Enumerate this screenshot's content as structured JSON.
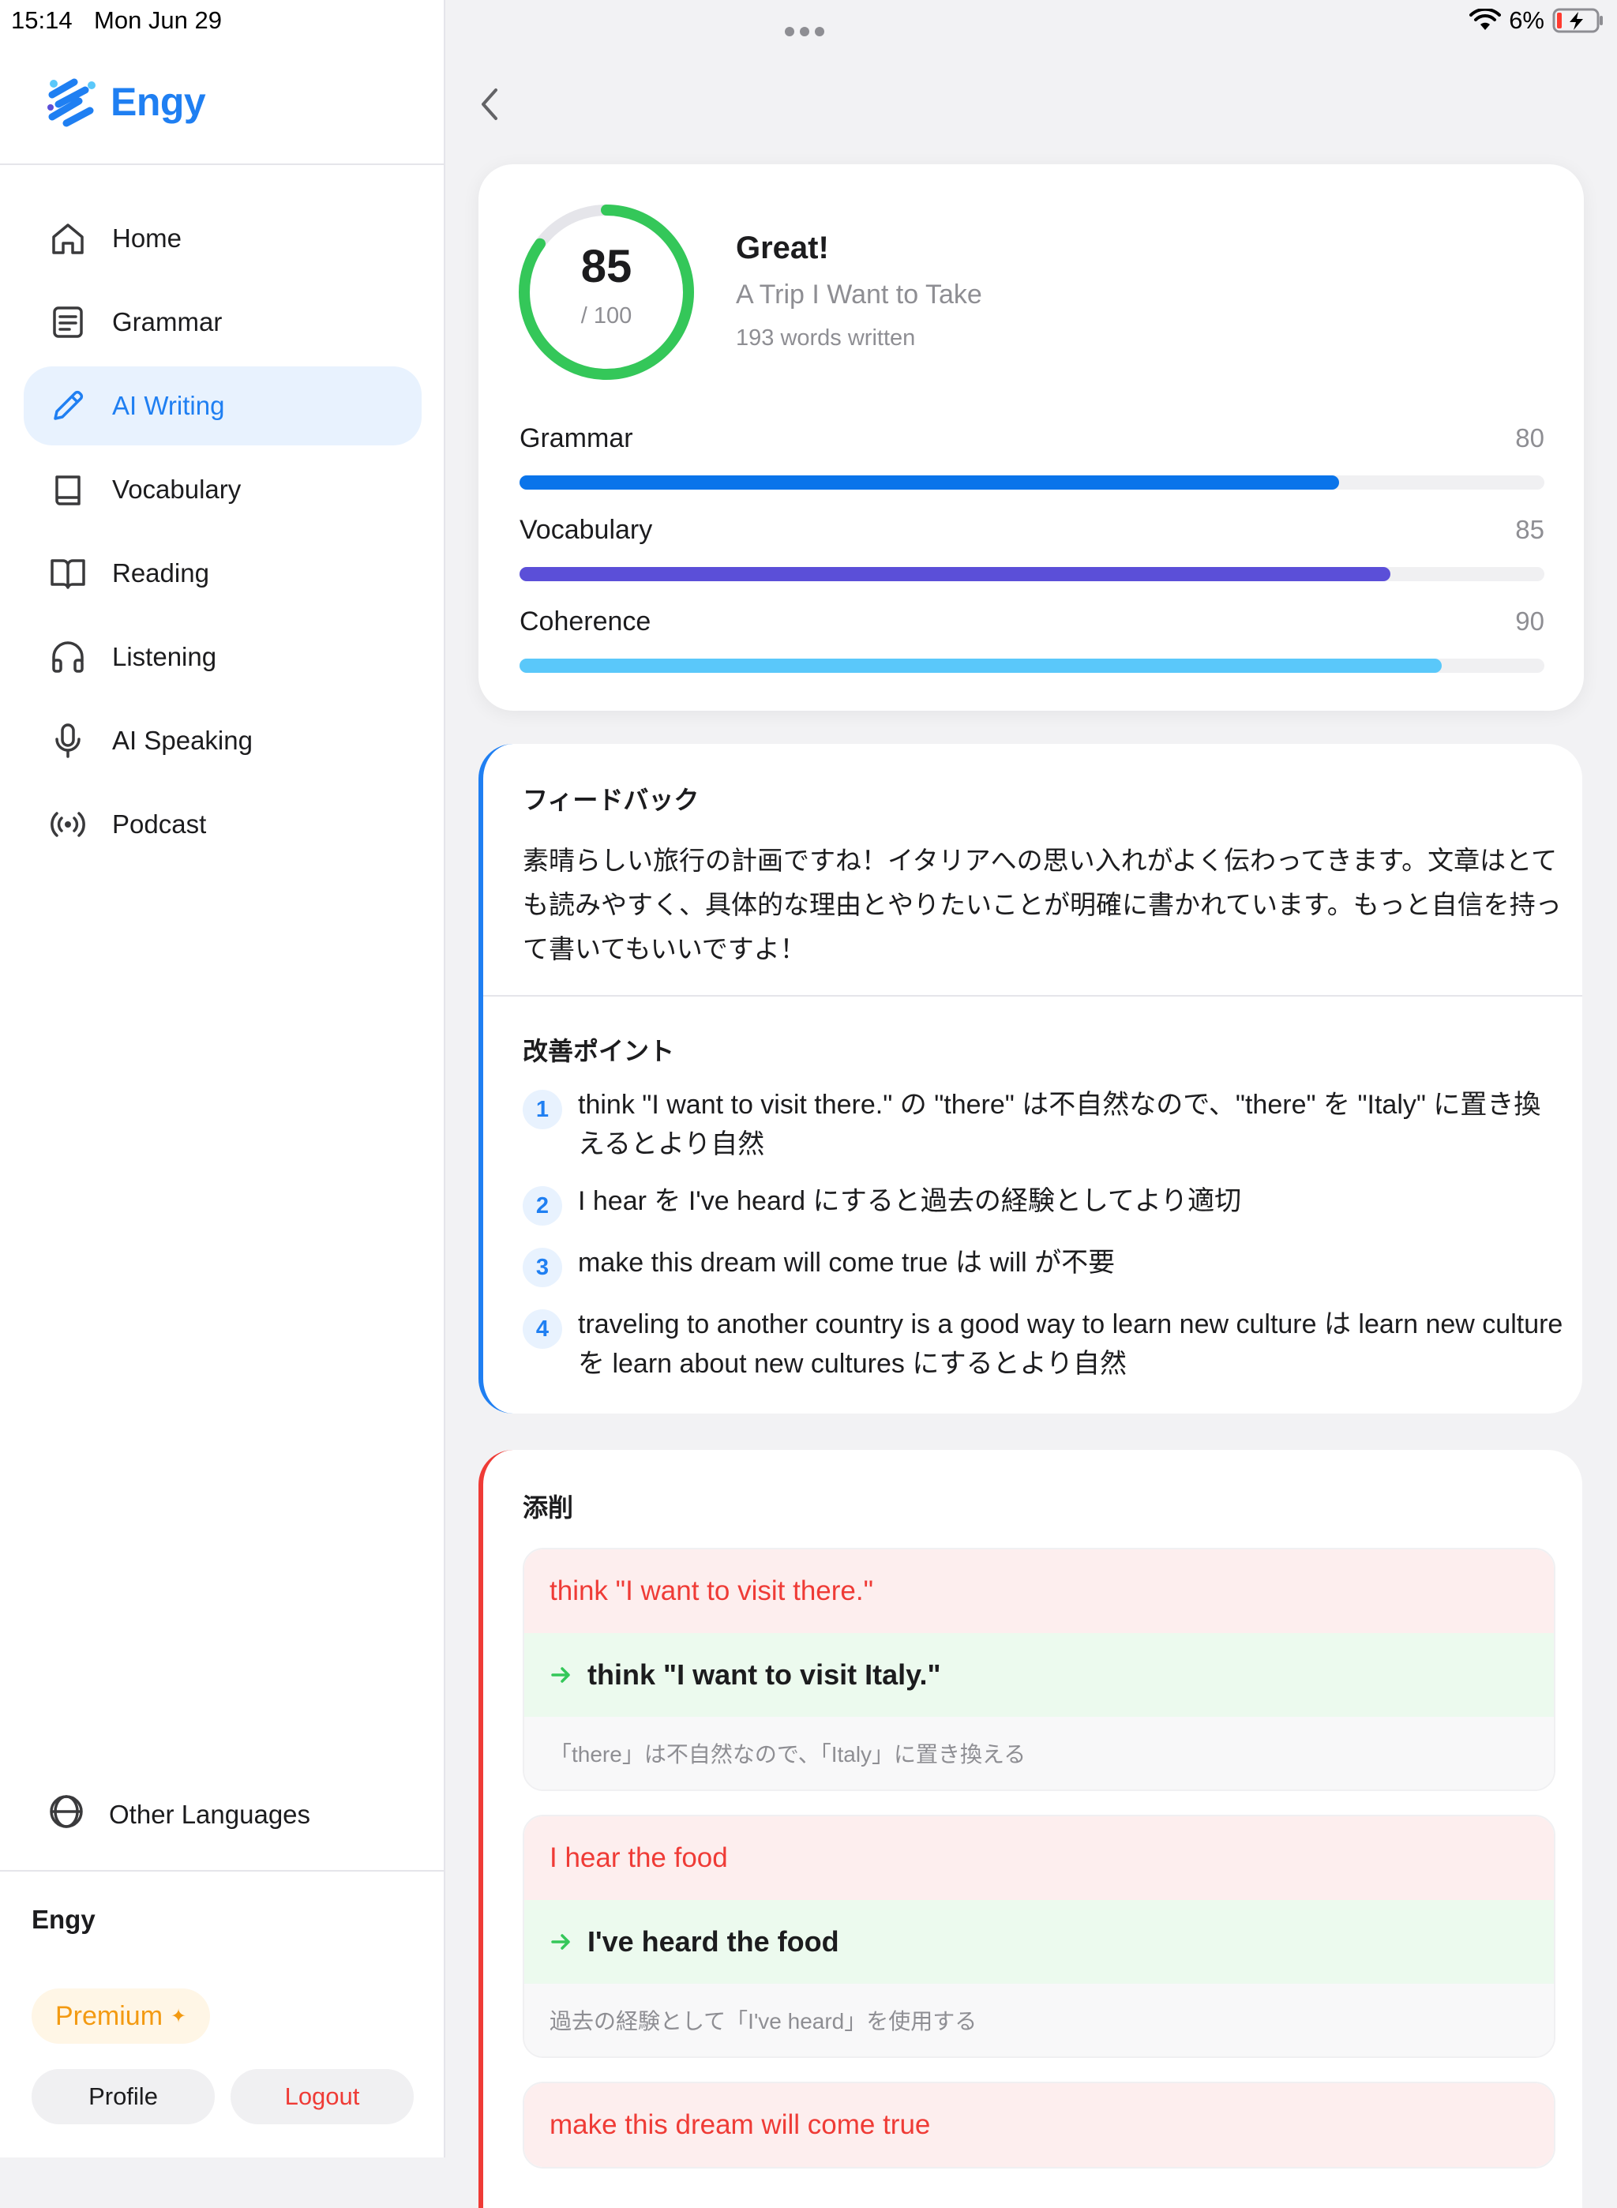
{
  "status": {
    "time": "15:14",
    "date": "Mon Jun 29",
    "battery": "6%"
  },
  "app": {
    "name": "Engy"
  },
  "sidebar": {
    "items": [
      {
        "label": "Home",
        "icon": "home-icon"
      },
      {
        "label": "Grammar",
        "icon": "document-icon"
      },
      {
        "label": "AI Writing",
        "icon": "pencil-icon",
        "active": true
      },
      {
        "label": "Vocabulary",
        "icon": "book-icon"
      },
      {
        "label": "Reading",
        "icon": "open-book-icon"
      },
      {
        "label": "Listening",
        "icon": "headphones-icon"
      },
      {
        "label": "AI Speaking",
        "icon": "microphone-icon"
      },
      {
        "label": "Podcast",
        "icon": "broadcast-icon"
      }
    ],
    "other_languages": "Other Languages",
    "user_name": "Engy",
    "premium": "Premium",
    "premium_mark": "✦",
    "profile": "Profile",
    "logout": "Logout"
  },
  "score": {
    "value": "85",
    "max": "/ 100",
    "fraction": 0.85,
    "headline": "Great!",
    "topic": "A Trip I Want to Take",
    "words": "193 words written",
    "metrics": [
      {
        "label": "Grammar",
        "value": "80",
        "fraction": 0.8,
        "color": "#0a74ea"
      },
      {
        "label": "Vocabulary",
        "value": "85",
        "fraction": 0.85,
        "color": "#5b4fd8"
      },
      {
        "label": "Coherence",
        "value": "90",
        "fraction": 0.9,
        "color": "#5ac8fa"
      }
    ],
    "ring_color": "#34c759"
  },
  "feedback": {
    "title": "フィードバック",
    "text": "素晴らしい旅行の計画ですね！イタリアへの思い入れがよく伝わってきます。文章はとても読みやすく、具体的な理由とやりたいことが明確に書かれています。もっと自信を持って書いてもいいですよ！",
    "improve_title": "改善ポイント",
    "points": [
      {
        "num": "1",
        "text": "think \"I want to visit there.\" の \"there\" は不自然なので、\"there\" を \"Italy\" に置き換えるとより自然"
      },
      {
        "num": "2",
        "text": "I hear を I've heard にすると過去の経験としてより適切"
      },
      {
        "num": "3",
        "text": "make this dream will come true は will が不要"
      },
      {
        "num": "4",
        "text": "traveling to another country is a good way to learn new culture は learn new culture を learn about new cultures にするとより自然"
      }
    ]
  },
  "corrections": {
    "title": "添削",
    "items": [
      {
        "original": "think \"I want to visit there.\"",
        "corrected": "think \"I want to visit Italy.\"",
        "note": "「there」は不自然なので、「Italy」に置き換える"
      },
      {
        "original": "I hear the food",
        "corrected": "I've heard the food",
        "note": "過去の経験として「I've heard」を使用する"
      },
      {
        "original": "make this dream will come true",
        "corrected": "",
        "note": ""
      }
    ]
  }
}
